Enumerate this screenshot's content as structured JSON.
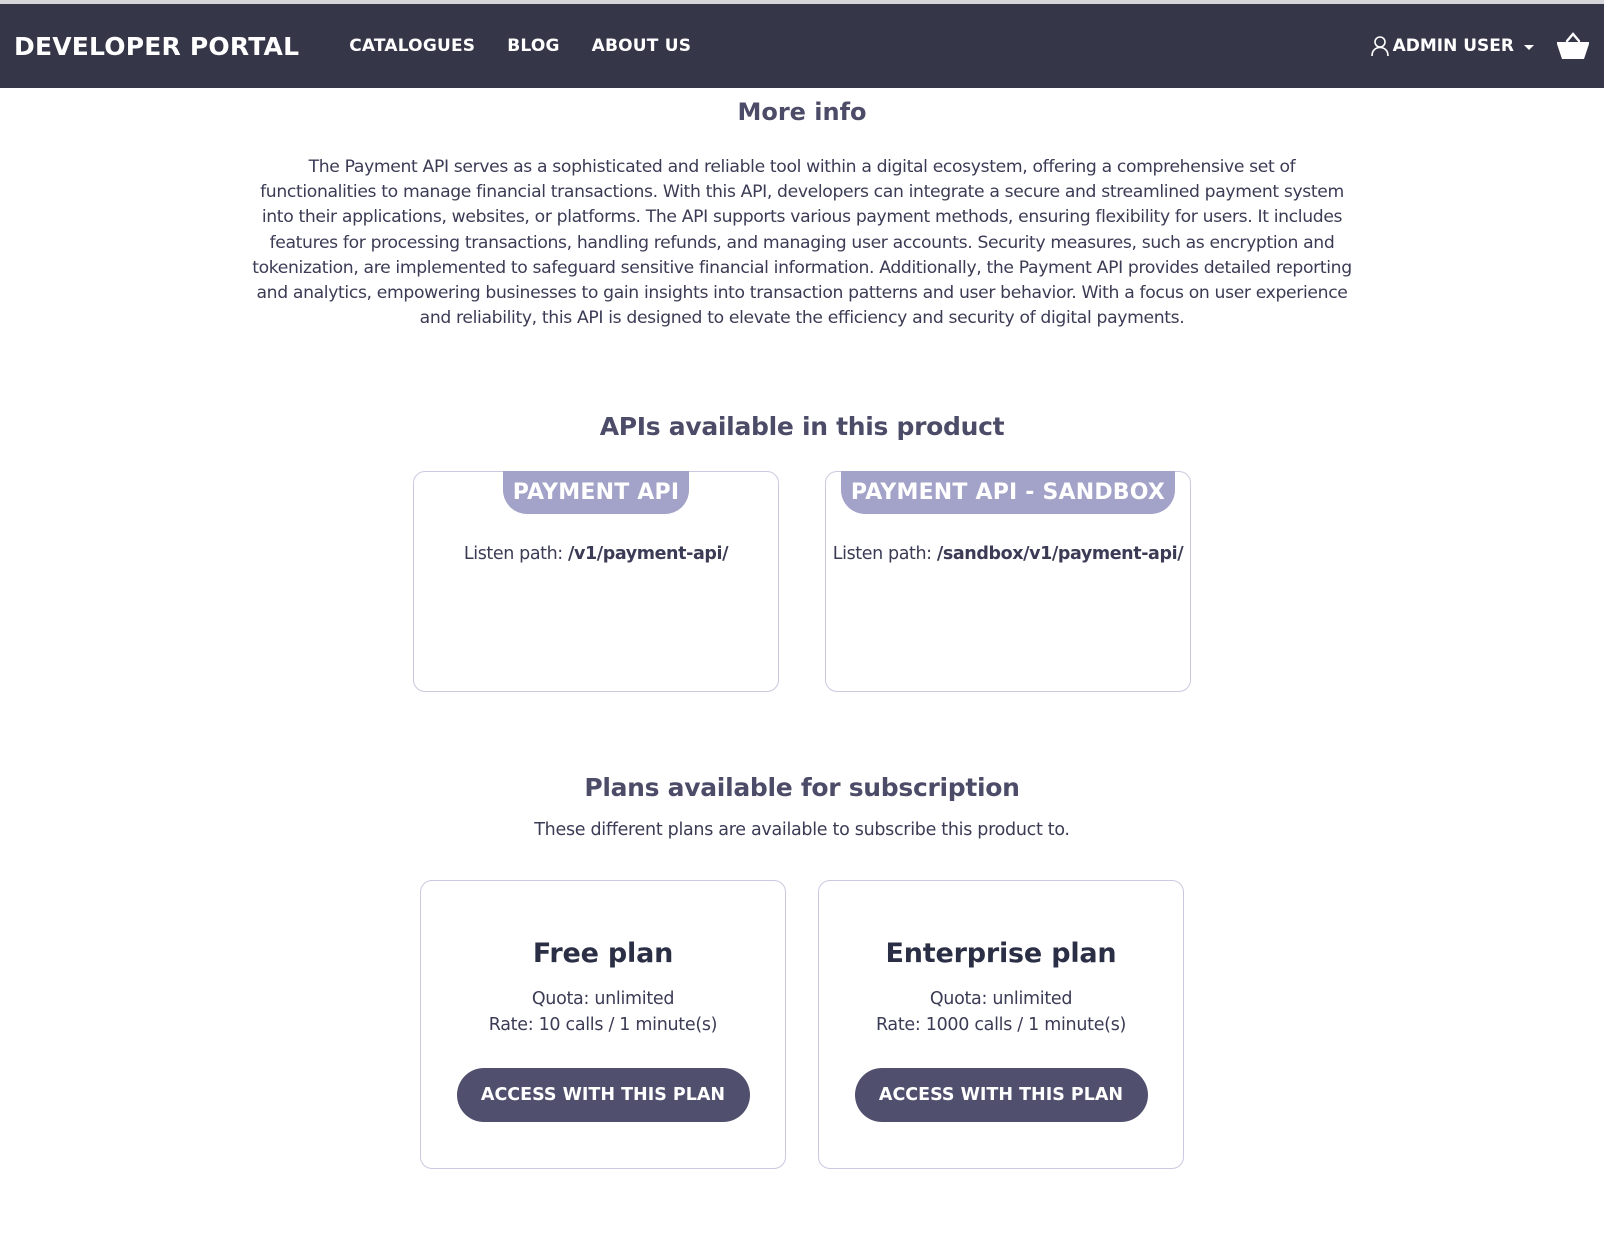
{
  "navbar": {
    "brand": "DEVELOPER PORTAL",
    "links": [
      {
        "label": "CATALOGUES"
      },
      {
        "label": "BLOG"
      },
      {
        "label": "ABOUT US"
      }
    ],
    "user_menu": {
      "label": "ADMIN USER",
      "icon": "user-icon",
      "dropdown_icon": "caret-down-icon"
    },
    "cart": {
      "icon": "cart-basket-icon"
    }
  },
  "more_info": {
    "title": "More info",
    "description": "The Payment API serves as a sophisticated and reliable tool within a digital ecosystem, offering a comprehensive set of functionalities to manage financial transactions. With this API, developers can integrate a secure and streamlined payment system into their applications, websites, or platforms. The API supports various payment methods, ensuring flexibility for users. It includes features for processing transactions, handling refunds, and managing user accounts. Security measures, such as encryption and tokenization, are implemented to safeguard sensitive financial information. Additionally, the Payment API provides detailed reporting and analytics, empowering businesses to gain insights into transaction patterns and user behavior. With a focus on user experience and reliability, this API is designed to elevate the efficiency and security of digital payments."
  },
  "apis": {
    "title": "APIs available in this product",
    "items": [
      {
        "name": "PAYMENT API",
        "listen_label": "Listen path:",
        "listen_path": "/v1/payment-api/"
      },
      {
        "name": "PAYMENT API - SANDBOX",
        "listen_label": "Listen path:",
        "listen_path": "/sandbox/v1/payment-api/"
      }
    ]
  },
  "plans": {
    "title": "Plans available for subscription",
    "subtitle": "These different plans are available to subscribe this product to.",
    "items": [
      {
        "name": "Free plan",
        "quota": "Quota: unlimited",
        "rate": "Rate: 10 calls / 1 minute(s)",
        "button_label": "ACCESS WITH THIS PLAN"
      },
      {
        "name": "Enterprise plan",
        "quota": "Quota: unlimited",
        "rate": "Rate: 1000 calls / 1 minute(s)",
        "button_label": "ACCESS WITH THIS PLAN"
      }
    ]
  },
  "colors": {
    "navbar_bg": "#363649",
    "heading": "#4c4c69",
    "badge_bg": "#a3a3c9",
    "button_bg": "#50506e",
    "card_border": "#c9c9e0"
  }
}
